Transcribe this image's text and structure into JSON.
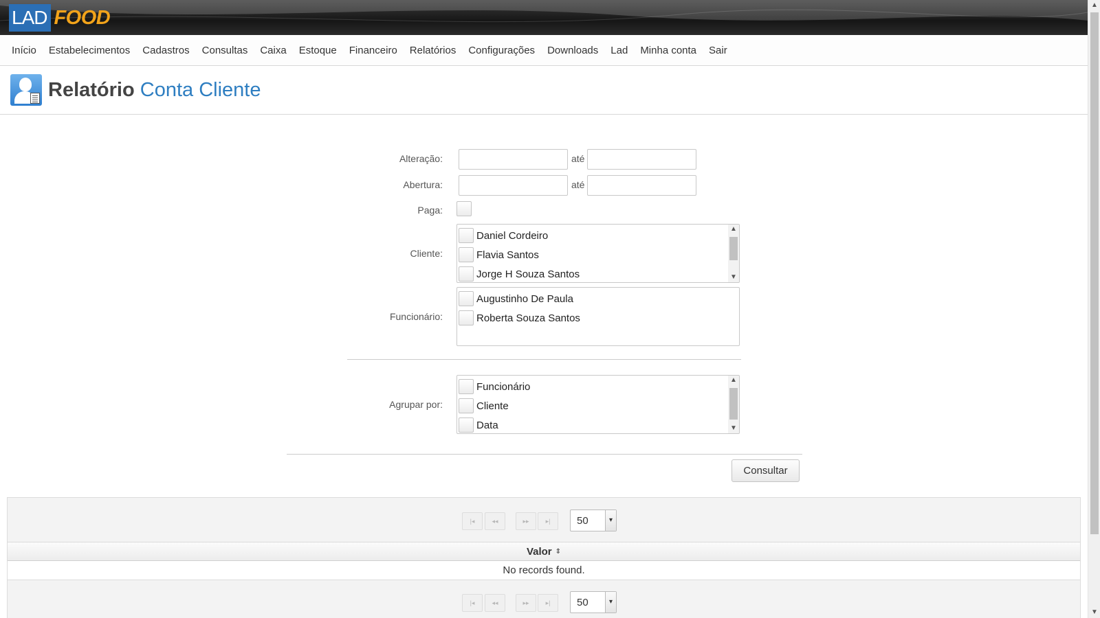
{
  "logo": {
    "part1": "LAD",
    "part2": "FOOD"
  },
  "menu": [
    "Início",
    "Estabelecimentos",
    "Cadastros",
    "Consultas",
    "Caixa",
    "Estoque",
    "Financeiro",
    "Relatórios",
    "Configurações",
    "Downloads",
    "Lad",
    "Minha conta",
    "Sair"
  ],
  "page": {
    "title_bold": "Relatório",
    "title_accent": "Conta Cliente"
  },
  "form": {
    "alteracao_label": "Alteração:",
    "abertura_label": "Abertura:",
    "ate": "até",
    "paga_label": "Paga:",
    "cliente_label": "Cliente:",
    "clientes": [
      "Daniel Cordeiro",
      "Flavia Santos",
      "Jorge H Souza Santos"
    ],
    "funcionario_label": "Funcionário:",
    "funcionarios": [
      "Augustinho De Paula",
      "Roberta Souza Santos"
    ],
    "agrupar_label": "Agrupar por:",
    "agrupar_options": [
      "Funcionário",
      "Cliente",
      "Data"
    ],
    "consultar": "Consultar"
  },
  "table": {
    "rows_per_page": "50",
    "column_valor": "Valor",
    "empty_message": "No records found."
  },
  "icons": {
    "first": "|◂",
    "prev": "◂◂",
    "next": "▸▸",
    "last": "▸|",
    "dropdown": "▾",
    "sort": "⇕",
    "scroll_up": "▲",
    "scroll_down": "▼"
  }
}
